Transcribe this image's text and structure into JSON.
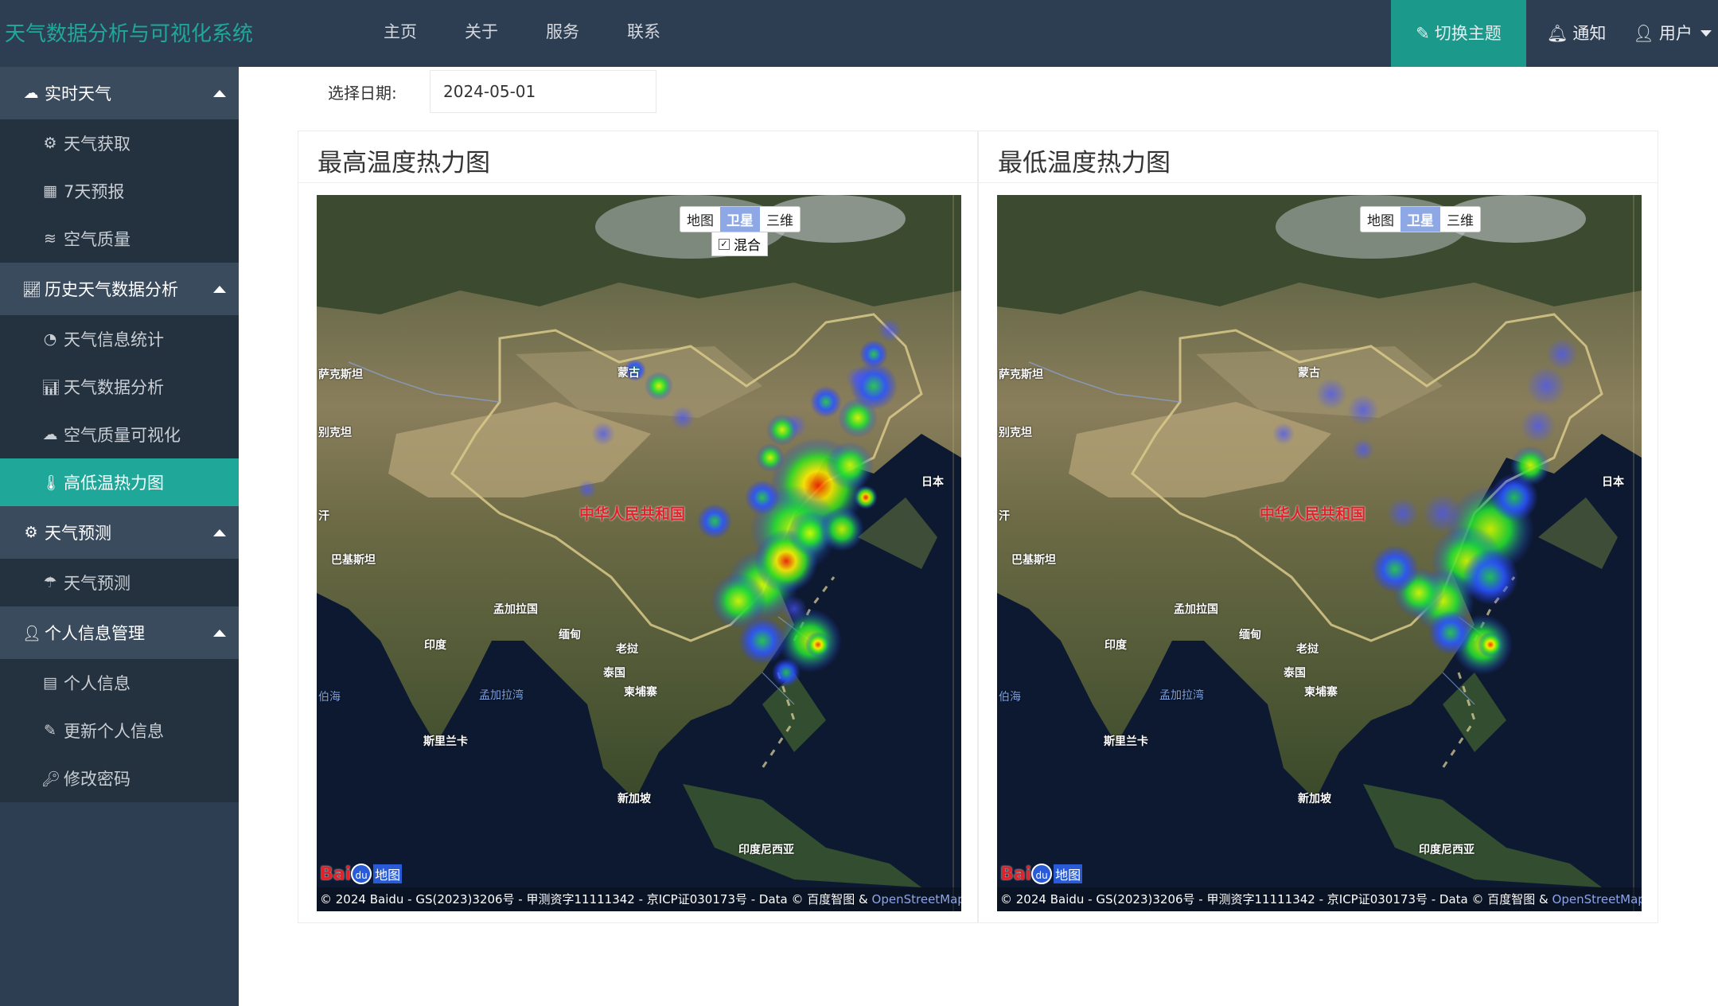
{
  "header": {
    "brand": "天气数据分析与可视化系统",
    "nav": [
      "主页",
      "关于",
      "服务",
      "联系"
    ],
    "theme_button": "切换主题",
    "notify": "通知",
    "user": "用户"
  },
  "sidebar": {
    "groups": [
      {
        "label": "实时天气",
        "items": [
          "天气获取",
          "7天预报",
          "空气质量"
        ]
      },
      {
        "label": "历史天气数据分析",
        "items": [
          "天气信息统计",
          "天气数据分析",
          "空气质量可视化",
          "高低温热力图"
        ]
      },
      {
        "label": "天气预测",
        "items": [
          "天气预测"
        ]
      },
      {
        "label": "个人信息管理",
        "items": [
          "个人信息",
          "更新个人信息",
          "修改密码"
        ]
      }
    ],
    "active_item": "高低温热力图"
  },
  "filter": {
    "label": "选择日期:",
    "date": "2024-05-01"
  },
  "panels": [
    {
      "title": "最高温度热力图"
    },
    {
      "title": "最低温度热力图"
    }
  ],
  "map": {
    "controls": {
      "map": "地图",
      "satellite": "卫星",
      "three_d": "三维"
    },
    "mix_label": "混合",
    "labels": {
      "kazakhstan": "萨克斯坦",
      "mongolia": "蒙古",
      "china": "中华人民共和国",
      "japan": "日本",
      "pakistan": "巴基斯坦",
      "bangladesh": "孟加拉国",
      "india": "印度",
      "myanmar": "缅甸",
      "laos": "老挝",
      "thailand": "泰国",
      "cambodia": "柬埔寨",
      "bay_of_bengal": "孟加拉湾",
      "arabian_sea": "伯海",
      "sri_lanka": "斯里兰卡",
      "singapore": "新加坡",
      "indonesia": "印度尼西亚",
      "afghan": "别克坦",
      "turkmen": "汗"
    },
    "logo_text": "Bai",
    "logo_paw": "du",
    "logo_suffix": "地图",
    "copyright": "© 2024 Baidu - GS(2023)3206号 - 甲测资字11111342 - 京ICP证030173号 - Data © 百度智图 & ",
    "osm": "OpenStreetMap"
  },
  "colors": {
    "accent": "#1fa89a",
    "topbar": "#2e3e52",
    "sidebar_sub": "#24313e"
  }
}
